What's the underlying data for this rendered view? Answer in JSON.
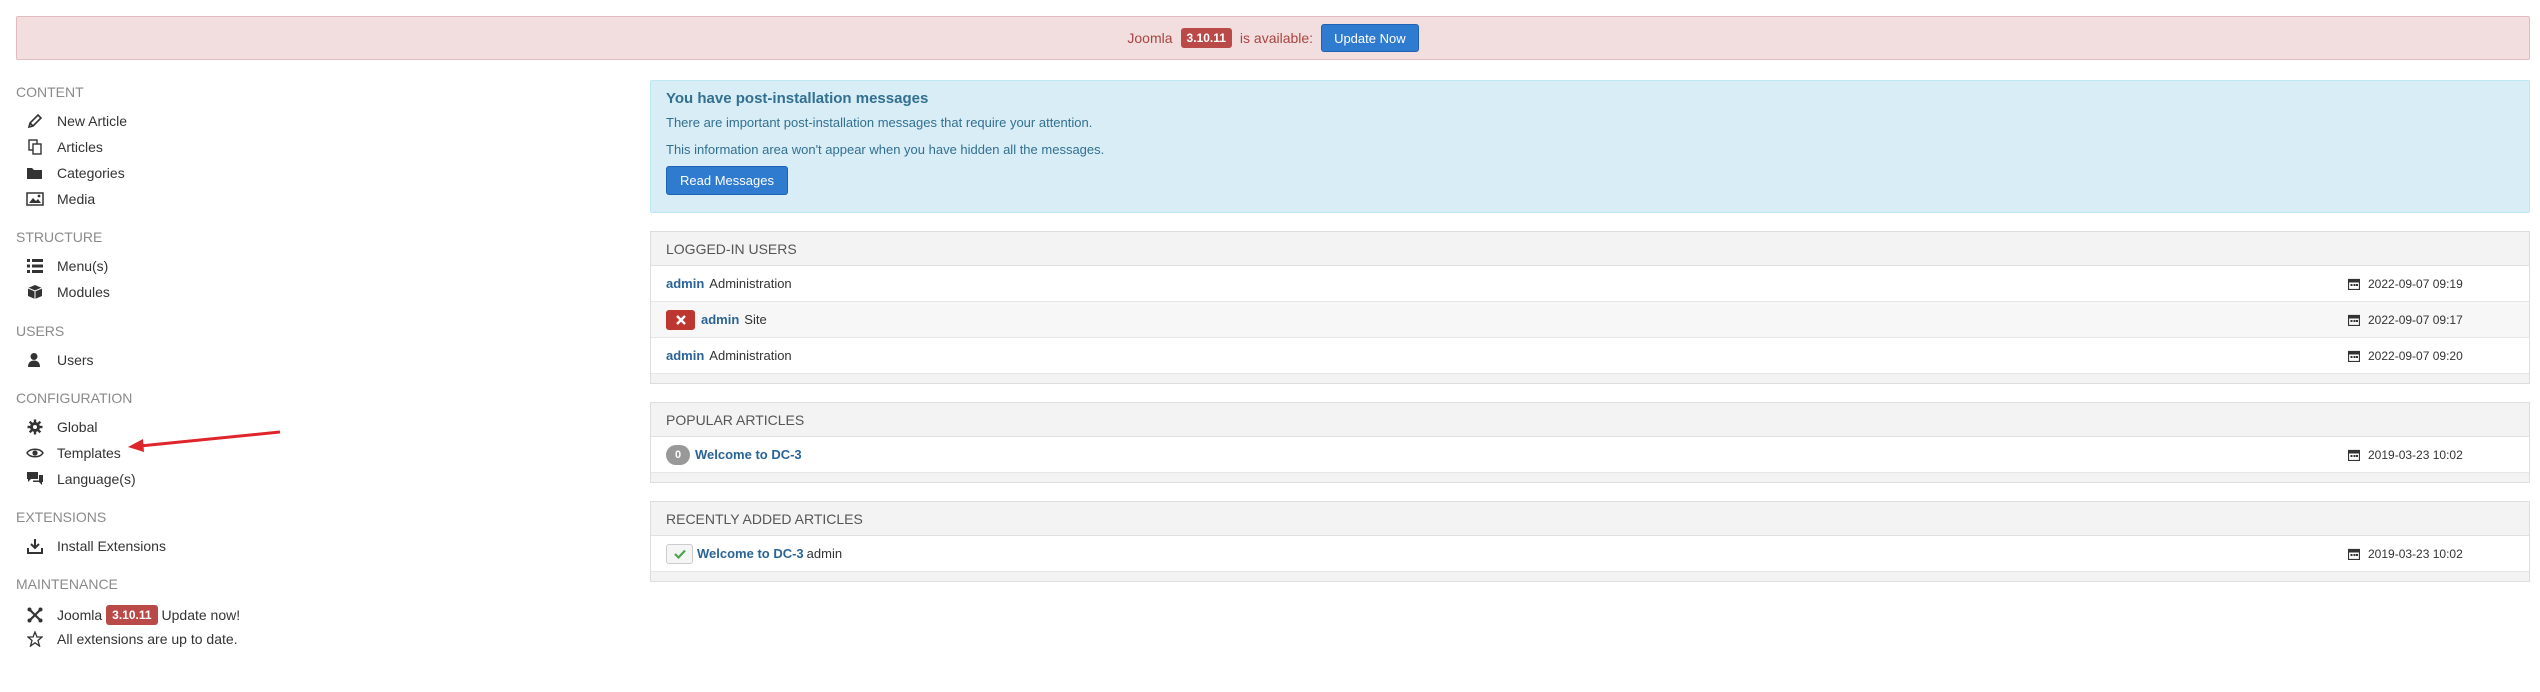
{
  "banner": {
    "prefix": "Joomla",
    "version": "3.10.11",
    "suffix": "is available:",
    "button_label": "Update Now"
  },
  "sidebar": {
    "sections": [
      {
        "heading": "CONTENT",
        "items": [
          {
            "label": "New Article",
            "icon": "pencil-icon"
          },
          {
            "label": "Articles",
            "icon": "copy-icon"
          },
          {
            "label": "Categories",
            "icon": "folder-icon"
          },
          {
            "label": "Media",
            "icon": "image-icon"
          }
        ]
      },
      {
        "heading": "STRUCTURE",
        "items": [
          {
            "label": "Menu(s)",
            "icon": "list-icon"
          },
          {
            "label": "Modules",
            "icon": "cube-icon"
          }
        ]
      },
      {
        "heading": "USERS",
        "items": [
          {
            "label": "Users",
            "icon": "user-icon"
          }
        ]
      },
      {
        "heading": "CONFIGURATION",
        "items": [
          {
            "label": "Global",
            "icon": "gear-icon"
          },
          {
            "label": "Templates",
            "icon": "eye-icon"
          },
          {
            "label": "Language(s)",
            "icon": "comments-icon"
          }
        ]
      },
      {
        "heading": "EXTENSIONS",
        "items": [
          {
            "label": "Install Extensions",
            "icon": "download-icon"
          }
        ]
      },
      {
        "heading": "MAINTENANCE",
        "items": [
          {
            "label_prefix": "Joomla",
            "version": "3.10.11",
            "label_suffix": "Update now!",
            "icon": "joomla-icon"
          },
          {
            "label": "All extensions are up to date.",
            "icon": "star-icon"
          }
        ]
      }
    ]
  },
  "postinstall": {
    "title": "You have post-installation messages",
    "line1": "There are important post-installation messages that require your attention.",
    "line2": "This information area won't appear when you have hidden all the messages.",
    "button_label": "Read Messages"
  },
  "logged_in": {
    "heading": "LOGGED-IN USERS",
    "rows": [
      {
        "user": "admin",
        "client": "Administration",
        "date": "2022-09-07 09:19"
      },
      {
        "user": "admin",
        "client": "Site",
        "date": "2022-09-07 09:17"
      },
      {
        "user": "admin",
        "client": "Administration",
        "date": "2022-09-07 09:20"
      }
    ]
  },
  "popular": {
    "heading": "POPULAR ARTICLES",
    "rows": [
      {
        "hits": "0",
        "title": "Welcome to DC-3",
        "date": "2019-03-23 10:02"
      }
    ]
  },
  "recent": {
    "heading": "RECENTLY ADDED ARTICLES",
    "rows": [
      {
        "title": "Welcome to DC-3",
        "author": "admin",
        "date": "2019-03-23 10:02"
      }
    ]
  },
  "colors": {
    "banner_bg": "#f2dede",
    "info_bg": "#d9edf7",
    "primary_button": "#2f7bd0",
    "link": "#2a6496",
    "annotation_arrow": "#e0242b"
  }
}
